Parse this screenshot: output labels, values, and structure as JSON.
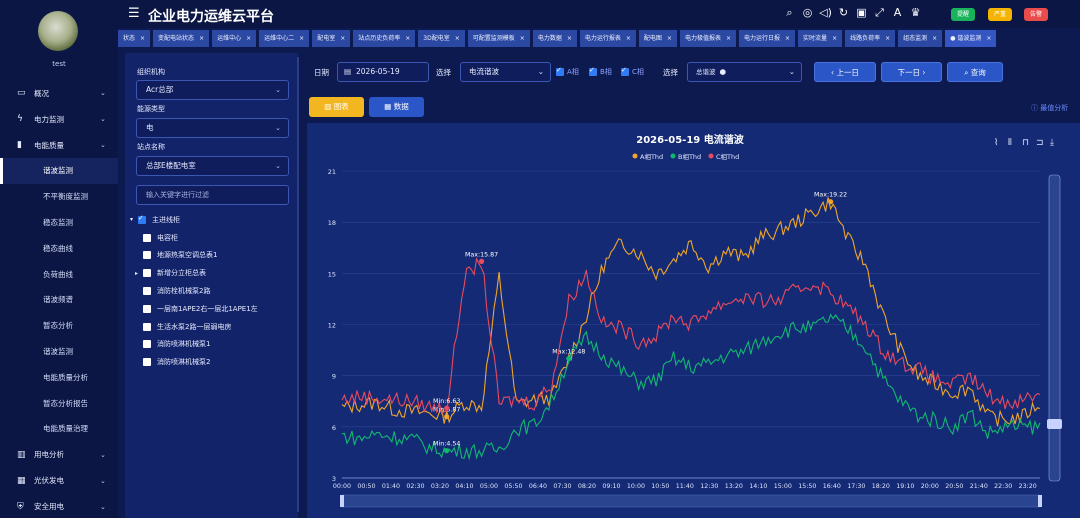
{
  "app": {
    "title": "企业电力运维云平台",
    "user": "test"
  },
  "badges": [
    {
      "label": "提醒",
      "color": "#18b35b"
    },
    {
      "label": "严重",
      "color": "#f4b400"
    },
    {
      "label": "告警",
      "color": "#ea4b4b"
    }
  ],
  "sidebar": {
    "items": [
      {
        "label": "概况",
        "icon": "monitor-icon",
        "type": "group"
      },
      {
        "label": "电力监测",
        "icon": "lightning-icon",
        "type": "group"
      },
      {
        "label": "电能质量",
        "icon": "bars-icon",
        "type": "group"
      },
      {
        "label": "谐波监测",
        "type": "sub",
        "active": true
      },
      {
        "label": "不平衡度监测",
        "type": "sub"
      },
      {
        "label": "稳态监测",
        "type": "sub"
      },
      {
        "label": "稳态曲线",
        "type": "sub"
      },
      {
        "label": "负荷曲线",
        "type": "sub"
      },
      {
        "label": "谐波频谱",
        "type": "sub"
      },
      {
        "label": "暂态分析",
        "type": "sub"
      },
      {
        "label": "谐波监测",
        "type": "sub"
      },
      {
        "label": "电能质量分析",
        "type": "sub"
      },
      {
        "label": "暂态分析报告",
        "type": "sub"
      },
      {
        "label": "电能质量治理",
        "type": "sub"
      },
      {
        "label": "用电分析",
        "icon": "chart-icon",
        "type": "group"
      },
      {
        "label": "光伏发电",
        "icon": "solar-icon",
        "type": "group"
      },
      {
        "label": "安全用电",
        "icon": "shield-icon",
        "type": "group"
      }
    ]
  },
  "tabs": [
    "状态",
    "变配电站状态",
    "运维中心",
    "运维中心二",
    "配电室",
    "站点历史负荷率",
    "3D配电室",
    "可配置监测模板",
    "电力数据",
    "电力运行报表",
    "配电图",
    "电力极值报表",
    "电力运行日报",
    "实时流量",
    "线路负荷率",
    "组态监测",
    "谐波监测"
  ],
  "filters": {
    "org_label": "组织机构",
    "org_value": "Acr总部",
    "energy_label": "能源类型",
    "energy_value": "电",
    "site_label": "站点名称",
    "site_value": "总部E楼配电室",
    "filter_placeholder": "输入关键字进行过滤"
  },
  "tree": {
    "root": "主进线柜",
    "nodes": [
      {
        "label": "电容柜"
      },
      {
        "label": "地源热泵空调总表1"
      },
      {
        "label": "新增分立柜总表",
        "expand": true
      },
      {
        "label": "消防栓机械泵2路"
      },
      {
        "label": "一层南1APE2右一层北1APE1左"
      },
      {
        "label": "生活水泵2路一层弱电房"
      },
      {
        "label": "消防喷淋机械泵1"
      },
      {
        "label": "消防喷淋机械泵2"
      }
    ]
  },
  "toolbar": {
    "date_label": "日期",
    "date_value": "2026-05-19",
    "select_label": "选择",
    "select_value": "电流谐波",
    "phases": [
      "A相",
      "B相",
      "C相"
    ],
    "select2_label": "选择",
    "select2_value": "总谐波",
    "prev": "上一日",
    "next": "下一日",
    "query": "查询",
    "btn_chart": "图表",
    "btn_data": "数据",
    "sync": "最值分析"
  },
  "chart_data": {
    "type": "line",
    "title": "2026-05-19  电流谐波",
    "ylim": [
      3,
      21
    ],
    "yticks": [
      3,
      6,
      9,
      12,
      15,
      18,
      21
    ],
    "xticks": [
      "00:00",
      "00:50",
      "01:40",
      "02:30",
      "03:20",
      "04:10",
      "05:00",
      "05:50",
      "06:40",
      "07:30",
      "08:20",
      "09:10",
      "10:00",
      "10:50",
      "11:40",
      "12:30",
      "13:20",
      "14:10",
      "15:00",
      "15:50",
      "16:40",
      "17:30",
      "18:20",
      "19:10",
      "20:00",
      "20:50",
      "21:40",
      "22:30",
      "23:20"
    ],
    "series": [
      {
        "name": "A相Thd",
        "color": "#f0a52b",
        "values": [
          7.1,
          7.3,
          7.4,
          7.0,
          6.9,
          6.8,
          6.6,
          7.4,
          7.2,
          14.8,
          7.3,
          7.6,
          7.7,
          10.0,
          12.5,
          15.5,
          16.8,
          16.2,
          15.0,
          15.8,
          16.8,
          15.4,
          16.3,
          15.9,
          17.1,
          17.5,
          18.0,
          18.6,
          19.2,
          17.0,
          15.5,
          12.5,
          10.5,
          9.0,
          8.5,
          8.0,
          8.3,
          6.6,
          6.4,
          6.6,
          7.4
        ],
        "max": {
          "label": "Max:19.22",
          "i": 28
        },
        "min": {
          "label": "Min:5.87",
          "i": 6
        }
      },
      {
        "name": "B相Thd",
        "color": "#12b870",
        "values": [
          5.5,
          5.3,
          5.6,
          5.4,
          5.3,
          4.8,
          4.6,
          4.6,
          4.6,
          4.7,
          5.9,
          6.1,
          7.5,
          10.0,
          11.2,
          10.2,
          9.3,
          8.6,
          8.7,
          10.0,
          9.5,
          9.7,
          10.2,
          10.4,
          11.0,
          11.5,
          11.8,
          11.8,
          12.4,
          11.7,
          10.7,
          8.8,
          7.5,
          6.7,
          6.4,
          6.0,
          6.8,
          5.6,
          6.0,
          6.0,
          6.0
        ],
        "max": {
          "label": "Max:12.48",
          "i": 13
        },
        "min": {
          "label": "Min:4.54",
          "i": 6
        }
      },
      {
        "name": "C相Thd",
        "color": "#e84a5f",
        "values": [
          7.6,
          7.8,
          7.7,
          7.6,
          7.5,
          7.2,
          7.1,
          14.7,
          15.7,
          7.4,
          7.6,
          7.4,
          8.5,
          13.4,
          15.0,
          12.0,
          11.8,
          11.0,
          11.3,
          12.5,
          12.0,
          12.8,
          13.3,
          13.6,
          13.4,
          13.4,
          14.0,
          14.4,
          13.9,
          13.0,
          12.0,
          10.5,
          9.8,
          9.4,
          8.8,
          8.5,
          8.9,
          7.9,
          7.4,
          7.6,
          8.0
        ],
        "max": {
          "label": "Max:15.87",
          "i": 8
        },
        "min": {
          "label": "Min:6.63",
          "i": 6
        }
      }
    ]
  }
}
